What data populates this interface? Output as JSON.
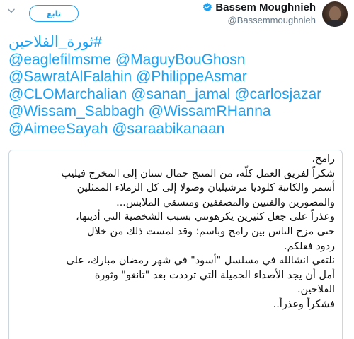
{
  "header": {
    "display_name": "Bassem Moughnieh",
    "handle": "@Bassemmoughnieh",
    "follow_label": "تابع",
    "verified_icon": "verified-badge-icon",
    "chevron_icon": "chevron-down-icon",
    "accent_color": "#1da1f2"
  },
  "tweet": {
    "hashtag": "#ثورة_الفلاحين",
    "mention_lines": [
      "@eaglefilmsme @MaguyBouGhosn",
      "@SawratAlFalahin @PhilippeAsmar",
      "@CLOMarchalian @sanan_jamal @carlosjazar",
      "@Wissam_Sabbagh @WissamRHanna",
      "@AimeeSayah @saraabikanaan"
    ]
  },
  "media": {
    "lines": [
      "رامح.",
      "شكراً لفريق العمل كلّه، من المنتج جمال سنان إلى المخرج فيليب",
      "أسمر والكاتبة كلوديا مرشيليان وصولا إلى كل الزملاء الممثلين",
      "والمصورين والفنيين والمصففين ومنسقي الملابس...",
      "وعذراً على جعل كثيرين يكرهونني بسبب الشخصية التي أديتها،",
      "حتى مزج الناس بين رامح وباسم؛ وقد لمست ذلك من خلال",
      "ردود فعلكم.",
      "نلتقي انشالله في مسلسل \"أسود\" في شهر رمضان مبارك، على",
      "أمل أن يجد الأصداء الجميلة التي ترددت بعد \"تانغو\" وثورة",
      "الفلاحين.",
      "فشكراً وعذراً.."
    ]
  }
}
